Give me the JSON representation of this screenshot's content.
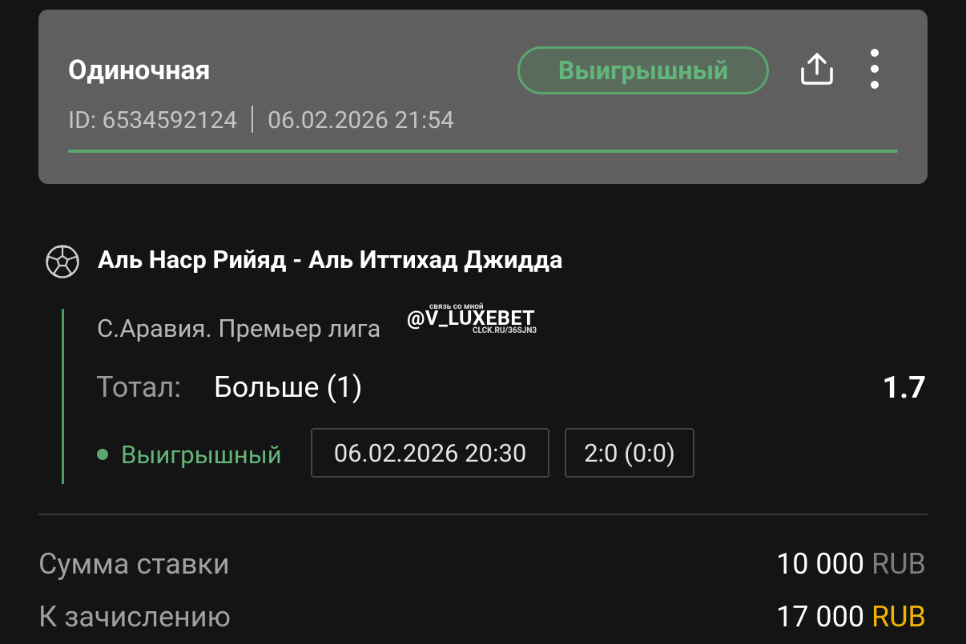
{
  "header": {
    "bet_type": "Одиночная",
    "status": "Выигрышный",
    "bet_id": "ID: 6534592124",
    "datetime": "06.02.2026 21:54",
    "progress_fraction": 1.0,
    "status_color": "#5aa66d"
  },
  "icons": {
    "share": "share-icon",
    "more": "more-vertical-icon",
    "sport": "soccer-ball-icon"
  },
  "event": {
    "match": "Аль Наср Рийяд - Аль Иттихад Джидда",
    "league": "С.Аравия. Премьер лига",
    "market_label": "Тотал:",
    "selection": "Больше (1)",
    "odds": "1.7",
    "result": "Выигрышный",
    "event_datetime": "06.02.2026 20:30",
    "score": "2:0 (0:0)"
  },
  "watermark": {
    "top": "связь со мной",
    "main": "@V_LUXEBET",
    "bottom": "CLCK.RU/36SJN3"
  },
  "summary": {
    "stake_label": "Сумма ставки",
    "stake_amount": "10 000",
    "stake_currency": "RUB",
    "payout_label": "К зачислению",
    "payout_amount": "17 000",
    "payout_currency": "RUB",
    "accent_color": "#f0b400"
  }
}
